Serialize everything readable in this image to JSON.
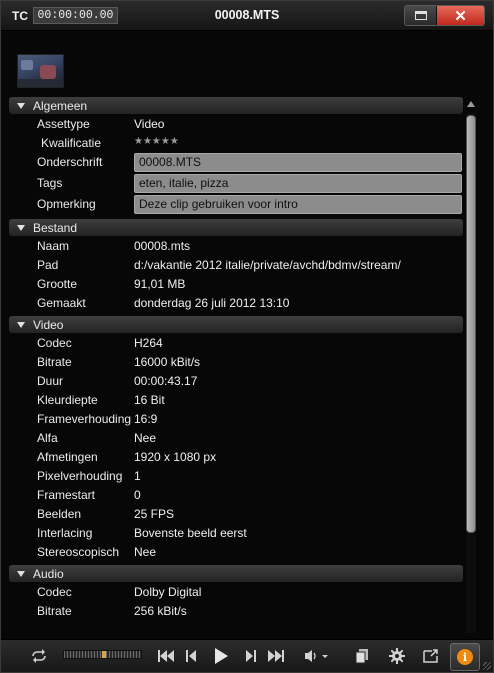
{
  "titlebar": {
    "tc_label": "TC",
    "timecode": "00:00:00.00",
    "title": "00008.MTS"
  },
  "sections": {
    "algemeen": {
      "title": "Algemeen",
      "assettype_label": "Assettype",
      "assettype_value": "Video",
      "kwalificatie_label": "Kwalificatie",
      "kwalificatie_stars": "★★★★★",
      "onderschrift_label": "Onderschrift",
      "onderschrift_value": "00008.MTS",
      "tags_label": "Tags",
      "tags_value": "eten, italie, pizza",
      "opmerking_label": "Opmerking",
      "opmerking_value": "Deze clip gebruiken voor intro"
    },
    "bestand": {
      "title": "Bestand",
      "rows": [
        {
          "label": "Naam",
          "value": "00008.mts"
        },
        {
          "label": "Pad",
          "value": "d:/vakantie 2012 italie/private/avchd/bdmv/stream/"
        },
        {
          "label": "Grootte",
          "value": "91,01 MB"
        },
        {
          "label": "Gemaakt",
          "value": "donderdag 26 juli 2012 13:10"
        }
      ]
    },
    "video": {
      "title": "Video",
      "rows": [
        {
          "label": "Codec",
          "value": "H264"
        },
        {
          "label": "Bitrate",
          "value": "16000 kBit/s"
        },
        {
          "label": "Duur",
          "value": "00:00:43.17"
        },
        {
          "label": "Kleurdiepte",
          "value": "16 Bit"
        },
        {
          "label": "Frameverhouding",
          "value": "16:9"
        },
        {
          "label": "Alfa",
          "value": "Nee"
        },
        {
          "label": "Afmetingen",
          "value": "1920 x 1080 px"
        },
        {
          "label": "Pixelverhouding",
          "value": "1"
        },
        {
          "label": "Framestart",
          "value": "0"
        },
        {
          "label": "Beelden",
          "value": "25 FPS"
        },
        {
          "label": "Interlacing",
          "value": "Bovenste beeld eerst"
        },
        {
          "label": "Stereoscopisch",
          "value": "Nee"
        }
      ]
    },
    "audio": {
      "title": "Audio",
      "rows": [
        {
          "label": "Codec",
          "value": "Dolby Digital"
        },
        {
          "label": "Bitrate",
          "value": "256 kBit/s"
        }
      ]
    }
  },
  "toolbar": {
    "icons": [
      "loop-icon",
      "jog-shuttle",
      "go-to-start-icon",
      "previous-frame-icon",
      "play-icon",
      "next-frame-icon",
      "go-to-end-icon",
      "volume-icon",
      "copy-icon",
      "settings-icon",
      "export-icon",
      "info-icon"
    ],
    "accent_color": "#f08a10"
  },
  "colors": {
    "background": "#070707",
    "section_header": "#2f2f2f",
    "field_background": "#8c8c8c",
    "close_button": "#c8392b"
  }
}
